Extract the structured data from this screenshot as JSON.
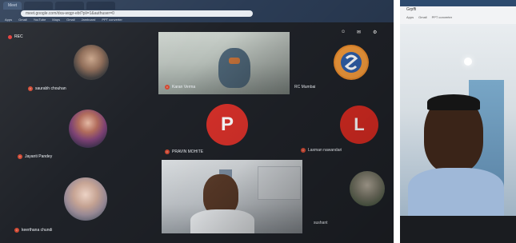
{
  "browser": {
    "tabs": [
      "Meet",
      "",
      "",
      "",
      "",
      ""
    ],
    "url": "meet.google.com/dxa-wqgr-ebt?pli=1&authuser=0",
    "bookmarks": [
      "Apps",
      "Gmail",
      "YouTube",
      "Maps",
      "Gmail",
      "Jamboard",
      "PPT converter"
    ]
  },
  "meeting": {
    "rec_label": "REC",
    "participants": [
      {
        "name": "saurabh chouhan"
      },
      {
        "name": "Karan Verma"
      },
      {
        "name": "RC Mumbai"
      },
      {
        "name": "Jayanti Pandey"
      },
      {
        "name": "PRAVIN MOHITE",
        "initial": "P"
      },
      {
        "name": "Laxman nawandari",
        "initial": "L"
      },
      {
        "name": "keerthana chundi"
      },
      {
        "name": "sushant"
      }
    ]
  },
  "right_photo": {
    "browser_tab": "Grpffi",
    "bookmarks": [
      "Apps",
      "Gmail",
      "PPT converter"
    ]
  },
  "colors": {
    "meet_bg": "#1f2228",
    "chrome": "#2b3c55",
    "avatar_p": "#d8312a",
    "avatar_l": "#d82b22"
  }
}
